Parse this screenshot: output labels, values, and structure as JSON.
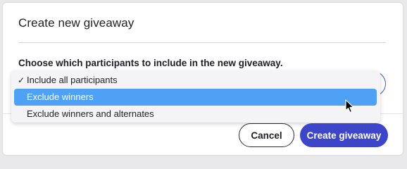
{
  "dialog": {
    "title": "Create new giveaway",
    "prompt": "Choose which participants to include in the new giveaway."
  },
  "dropdown": {
    "options": [
      {
        "label": "Include all participants",
        "checked": true
      },
      {
        "label": "Exclude winners",
        "highlighted": true
      },
      {
        "label": "Exclude winners and alternates"
      }
    ],
    "check_glyph": "✓"
  },
  "footer": {
    "cancel_label": "Cancel",
    "create_label": "Create giveaway"
  },
  "colors": {
    "accent": "#3d45c9",
    "highlight": "#4ea1f5"
  },
  "icons": {
    "cursor": "mouse-pointer-icon",
    "check": "checkmark-icon"
  }
}
